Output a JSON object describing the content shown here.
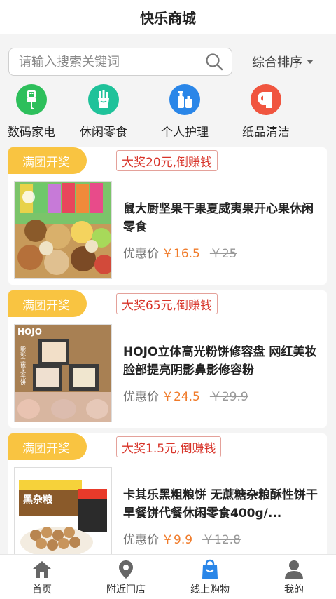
{
  "header": {
    "title": "快乐商城"
  },
  "search": {
    "placeholder": "请输入搜索关键词",
    "sort_label": "综合排序"
  },
  "categories": [
    {
      "label": "数码家电",
      "icon": "usb-cable-icon",
      "color": "#2dbf5b"
    },
    {
      "label": "休闲零食",
      "icon": "fries-icon",
      "color": "#1fc29a"
    },
    {
      "label": "个人护理",
      "icon": "skincare-bottles-icon",
      "color": "#2a86e8"
    },
    {
      "label": "纸品清洁",
      "icon": "toilet-roll-icon",
      "color": "#f0553f"
    }
  ],
  "products": [
    {
      "tag": "满团开奖",
      "prize": "大奖20元,倒赚钱",
      "name": "鼠大厨坚果干果夏威夷果开心果休闲零食",
      "price_label": "优惠价",
      "price": "￥16.5",
      "old_price": "￥25"
    },
    {
      "tag": "满团开奖",
      "prize": "大奖65元,倒赚钱",
      "name": "HOJO立体高光粉饼修容盘 网红美妆脸部提亮阴影鼻影修容粉",
      "price_label": "优惠价",
      "price": "￥24.5",
      "old_price": "￥29.9"
    },
    {
      "tag": "满团开奖",
      "prize": "大奖1.5元,倒赚钱",
      "name": "卡其乐黑粗粮饼 无蔗糖杂粮酥性饼干 早餐饼代餐休闲零食400g/...",
      "price_label": "优惠价",
      "price": "￥9.9",
      "old_price": "￥12.8"
    }
  ],
  "image_text": {
    "hojo_logo": "HOJO",
    "hojo_side": "能彩立体水光饼",
    "snack_box": "黑杂粮"
  },
  "tabbar": [
    {
      "label": "首页",
      "icon": "home-icon"
    },
    {
      "label": "附近门店",
      "icon": "location-pin-icon"
    },
    {
      "label": "线上购物",
      "icon": "shopping-bag-icon",
      "active": true
    },
    {
      "label": "我的",
      "icon": "user-icon"
    }
  ],
  "colors": {
    "accent": "#2a86e8",
    "tag": "#f9c441",
    "price": "#f07b2a",
    "prize": "#d8342a"
  }
}
